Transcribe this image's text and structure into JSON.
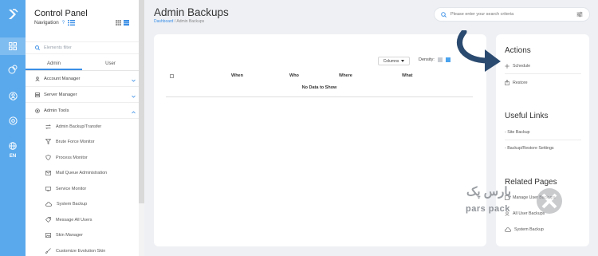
{
  "rail": {
    "items": [
      {
        "icon": "grid-icon"
      },
      {
        "icon": "accounts-icon"
      },
      {
        "icon": "user-circle-icon"
      },
      {
        "icon": "settings-icon"
      },
      {
        "icon": "globe-icon"
      }
    ],
    "lang": "EN"
  },
  "sidebar": {
    "title": "Control Panel",
    "nav_label": "Navigation",
    "filter_placeholder": "Elements filter",
    "tabs": [
      "Admin",
      "User"
    ],
    "groups": [
      {
        "label": "Account Manager"
      },
      {
        "label": "Server Manager"
      },
      {
        "label": "Admin Tools"
      }
    ],
    "items": [
      {
        "label": "Admin Backup/Transfer",
        "icon": "transfer-icon"
      },
      {
        "label": "Brute Force Monitor",
        "icon": "filter-icon"
      },
      {
        "label": "Process Monitor",
        "icon": "shield-icon"
      },
      {
        "label": "Mail Queue Administration",
        "icon": "mail-icon"
      },
      {
        "label": "Service Monitor",
        "icon": "monitor-icon"
      },
      {
        "label": "System Backup",
        "icon": "cloud-icon"
      },
      {
        "label": "Message All Users",
        "icon": "tag-icon"
      },
      {
        "label": "Skin Manager",
        "icon": "image-icon"
      },
      {
        "label": "Customize Evolution Skin",
        "icon": "brush-icon"
      }
    ]
  },
  "main": {
    "title": "Admin Backups",
    "breadcrumb": {
      "link": "Dashboard",
      "sep": " / ",
      "current": "Admin Backups"
    },
    "search_placeholder": "Please enter your search criteria",
    "table": {
      "columns_label": "Columns",
      "density_label": "Density:",
      "headers": [
        "When",
        "Who",
        "Where",
        "What"
      ],
      "empty_text": "No Data to Show"
    }
  },
  "right": {
    "actions_title": "Actions",
    "actions": [
      {
        "label": "Schedule",
        "icon": "plus-icon"
      },
      {
        "label": "Restore",
        "icon": "restore-icon"
      }
    ],
    "links_title": "Useful Links",
    "links": [
      "- Site Backup",
      "- Backup/Restore Settings"
    ],
    "related_title": "Related Pages",
    "related": [
      {
        "label": "Manage User Backups",
        "icon": "backup-icon"
      },
      {
        "label": "All User Backups",
        "icon": "users-icon"
      },
      {
        "label": "System Backup",
        "icon": "cloud-icon"
      }
    ]
  },
  "watermark": {
    "text": "pars pack",
    "text_fa": "پارس پک"
  },
  "colors": {
    "accent": "#5aa9ec",
    "arrow": "#2b4a6f",
    "link": "#3a8ee6"
  }
}
